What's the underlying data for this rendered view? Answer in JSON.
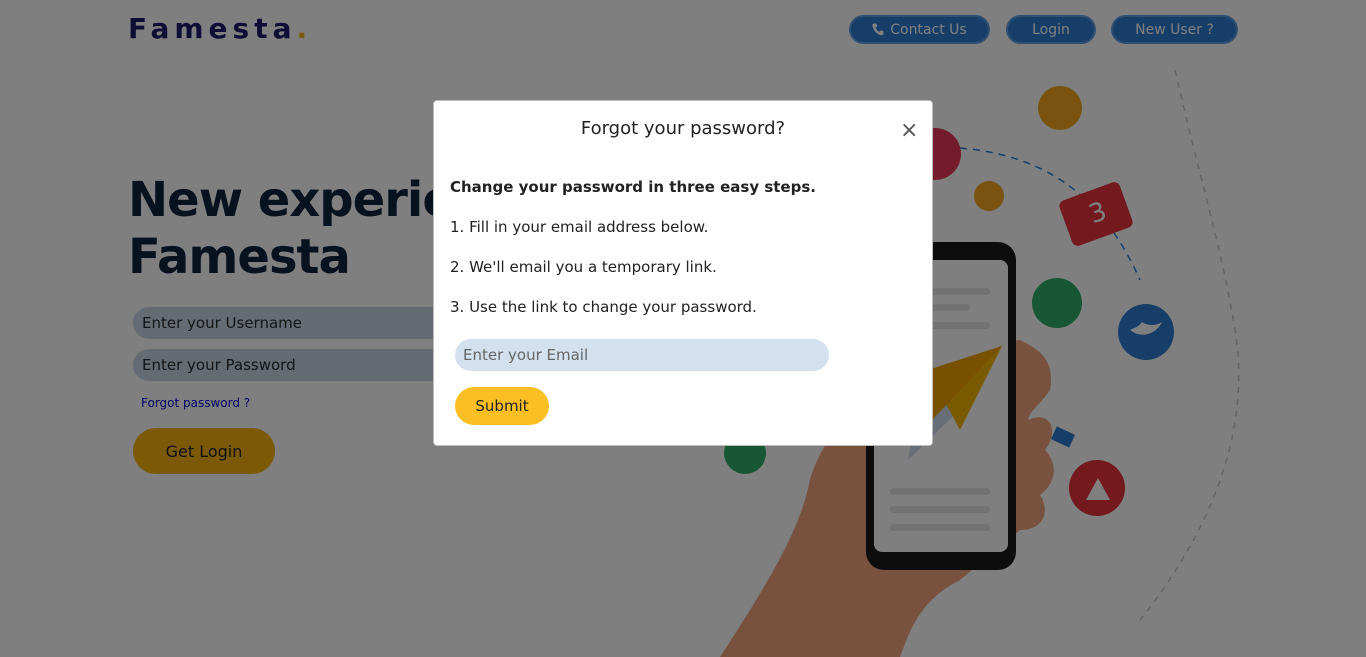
{
  "header": {
    "logo_text": "Famesta",
    "logo_dot": ".",
    "nav": {
      "contact_label": "Contact Us",
      "login_label": "Login",
      "new_user_label": "New User ?"
    }
  },
  "hero": {
    "headline_line1": "New experie",
    "headline_line2": "Famesta"
  },
  "login_form": {
    "username_placeholder": "Enter your Username",
    "password_placeholder": "Enter your Password",
    "forgot_link": "Forgot password ?",
    "submit_label": "Get Login"
  },
  "modal": {
    "title": "Forgot your password?",
    "close_glyph": "×",
    "intro": "Change your password in three easy steps.",
    "steps": [
      "1. Fill in your email address below.",
      "2. We'll email you a temporary link.",
      "3. Use the link to change your password."
    ],
    "email_placeholder": "Enter your Email",
    "submit_label": "Submit"
  },
  "icons": {
    "contact": "phone-icon",
    "close": "close-icon"
  },
  "colors": {
    "brand_navy": "#1b1b6b",
    "accent_yellow": "#fbbf24",
    "nav_blue": "#2f7cd3"
  }
}
